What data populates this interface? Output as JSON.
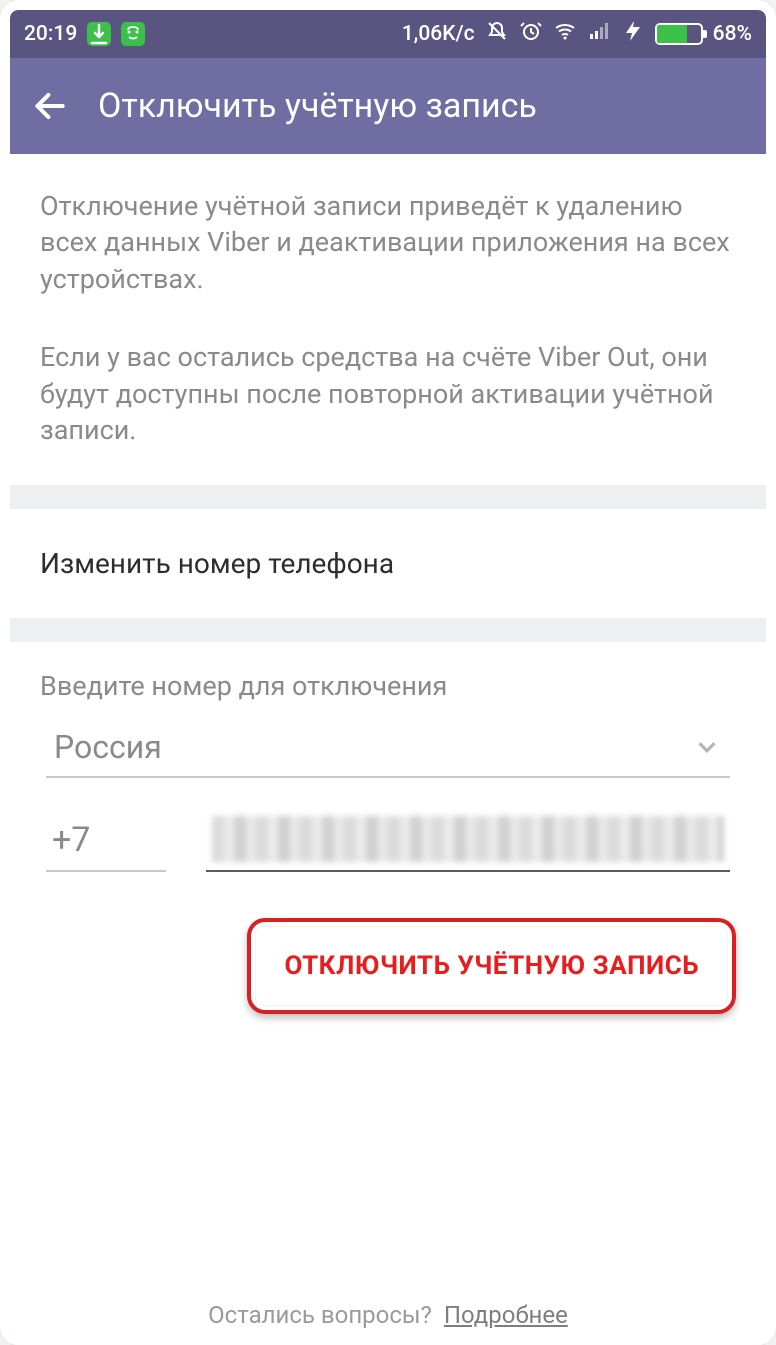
{
  "status": {
    "time": "20:19",
    "net_speed": "1,06K/c",
    "battery_pct": "68%"
  },
  "appbar": {
    "title": "Отключить учётную запись"
  },
  "info": {
    "p1": "Отключение учётной записи приведёт к удалению всех данных Viber и деактивации приложения на всех устройствах.",
    "p2": "Если у вас остались средства на счёте Viber Out, они будут доступны после повторной активации учётной записи."
  },
  "change_phone": {
    "label": "Изменить номер телефона"
  },
  "form": {
    "section_label": "Введите номер для отключения",
    "country": "Россия",
    "code": "+7",
    "number_redacted": ""
  },
  "actions": {
    "deactivate": "ОТКЛЮЧИТЬ УЧЁТНУЮ ЗАПИСЬ"
  },
  "footer": {
    "text": "Остались вопросы?",
    "link": "Подробнее"
  }
}
